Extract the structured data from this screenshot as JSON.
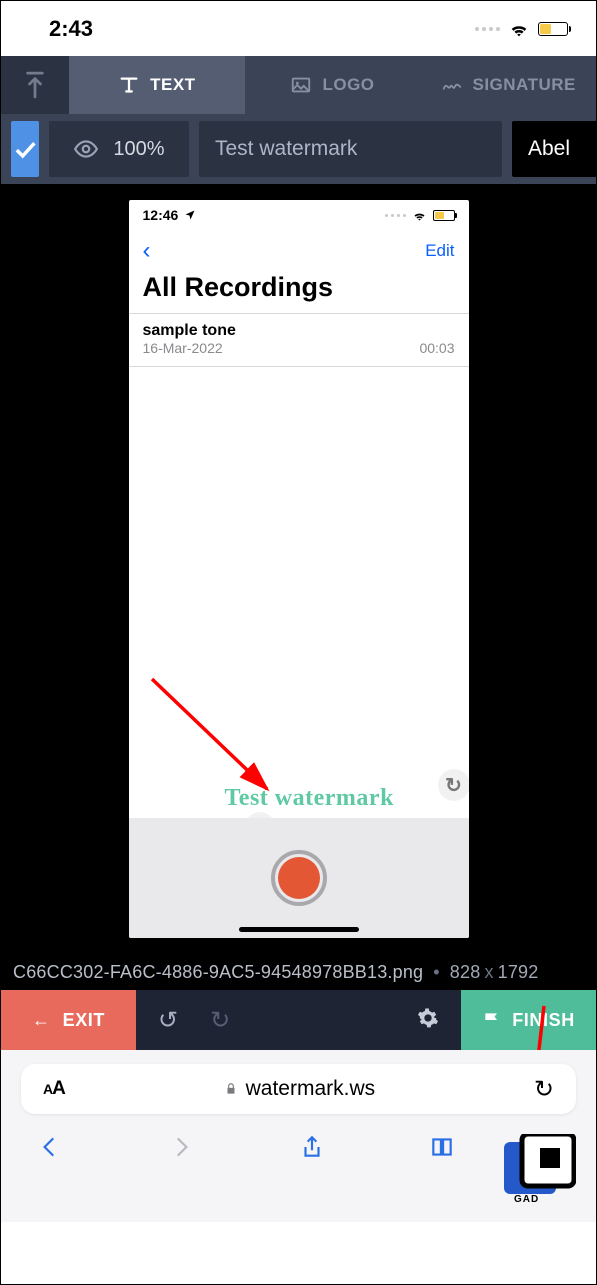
{
  "outer_status": {
    "time": "2:43"
  },
  "tabs": {
    "text": "TEXT",
    "logo": "LOGO",
    "signature": "SIGNATURE"
  },
  "controls": {
    "opacity": "100%",
    "watermark_text": "Test watermark",
    "font": "Abel"
  },
  "inner": {
    "time": "12:46",
    "edit": "Edit",
    "title": "All Recordings",
    "recording": {
      "name": "sample tone",
      "date": "16-Mar-2022",
      "duration": "00:03"
    }
  },
  "watermark_overlay": "Test watermark",
  "file": {
    "name": "C66CC302-FA6C-4886-9AC5-94548978BB13.png",
    "w": "828",
    "h": "1792"
  },
  "actions": {
    "exit": "EXIT",
    "finish": "FINISH"
  },
  "safari": {
    "aa_small": "A",
    "aa_big": "A",
    "url": "watermark.ws"
  }
}
